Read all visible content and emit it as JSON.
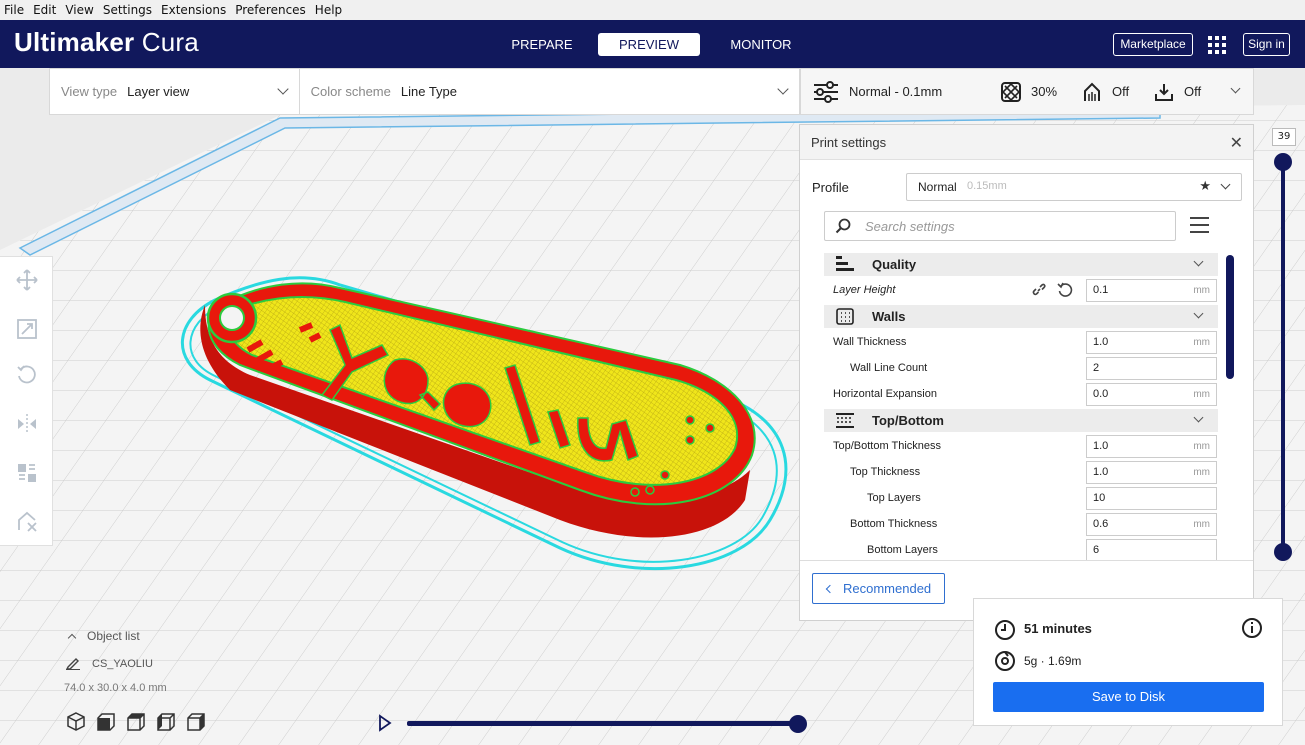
{
  "menubar": {
    "items": [
      {
        "label": "File"
      },
      {
        "label": "Edit"
      },
      {
        "label": "View"
      },
      {
        "label": "Settings"
      },
      {
        "label": "Extensions"
      },
      {
        "label": "Preferences"
      },
      {
        "label": "Help"
      }
    ]
  },
  "header": {
    "logo_bold": "Ultimaker",
    "logo_light": "Cura",
    "tabs": [
      {
        "label": "PREPARE"
      },
      {
        "label": "PREVIEW",
        "active": true
      },
      {
        "label": "MONITOR"
      }
    ],
    "marketplace_label": "Marketplace",
    "signin_label": "Sign in",
    "background_color": "#11185c"
  },
  "view_toolbar": {
    "view_type_label": "View type",
    "view_type_value": "Layer view",
    "color_scheme_label": "Color scheme",
    "color_scheme_value": "Line Type"
  },
  "print_setup_bar": {
    "profile_summary": "Normal - 0.1mm",
    "infill": "30%",
    "support": "Off",
    "adhesion": "Off"
  },
  "print_settings": {
    "title": "Print settings",
    "profile_label": "Profile",
    "profile_name": "Normal",
    "profile_layer": "0.15mm",
    "search_placeholder": "Search settings",
    "categories": [
      {
        "label": "Quality",
        "icon": "quality-icon"
      },
      {
        "label": "Walls",
        "icon": "walls-icon"
      },
      {
        "label": "Top/Bottom",
        "icon": "top-bottom-icon"
      }
    ],
    "rows": [
      {
        "label": "Layer Height",
        "value": "0.1",
        "unit": "mm"
      },
      {
        "label": "Wall Thickness",
        "value": "1.0",
        "unit": "mm"
      },
      {
        "label": "Wall Line Count",
        "value": "2",
        "unit": ""
      },
      {
        "label": "Horizontal Expansion",
        "value": "0.0",
        "unit": "mm"
      },
      {
        "label": "Top/Bottom Thickness",
        "value": "1.0",
        "unit": "mm"
      },
      {
        "label": "Top Thickness",
        "value": "1.0",
        "unit": "mm"
      },
      {
        "label": "Top Layers",
        "value": "10",
        "unit": ""
      },
      {
        "label": "Bottom Thickness",
        "value": "0.6",
        "unit": "mm"
      },
      {
        "label": "Bottom Layers",
        "value": "6",
        "unit": ""
      }
    ],
    "recommended_label": "Recommended"
  },
  "layer_slider": {
    "current_layer": "39"
  },
  "object_list": {
    "toggle_label": "Object list",
    "object_name": "CS_YAOLIU",
    "dimensions": "74.0 x 30.0 x 4.0 mm"
  },
  "print_info": {
    "time": "51 minutes",
    "material": "5g · 1.69m",
    "save_label": "Save to Disk"
  },
  "colors": {
    "accent": "#196ef0",
    "dark": "#11185c",
    "model_wall": "#e8180c",
    "model_infill": "#f0e61a",
    "inner_wall": "#2bcb3e",
    "skirt": "#29d9e0"
  }
}
